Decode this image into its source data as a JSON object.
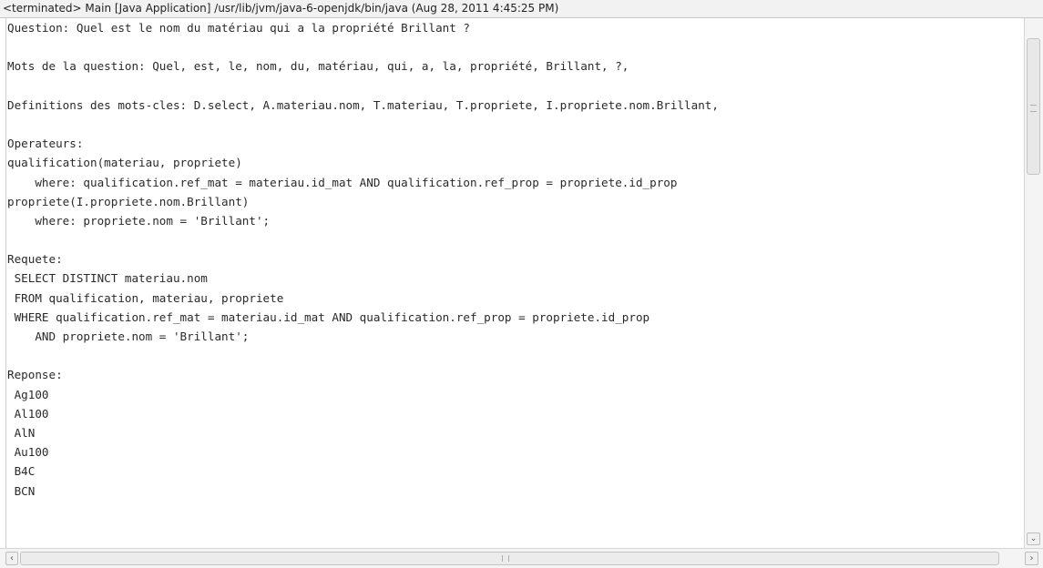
{
  "console": {
    "title": "<terminated> Main [Java Application] /usr/lib/jvm/java-6-openjdk/bin/java (Aug 28, 2011 4:45:25 PM)",
    "lines": [
      "Question: Quel est le nom du matériau qui a la propriété Brillant ?",
      "",
      "Mots de la question: Quel, est, le, nom, du, matériau, qui, a, la, propriété, Brillant, ?,",
      "",
      "Definitions des mots-cles: D.select, A.materiau.nom, T.materiau, T.propriete, I.propriete.nom.Brillant,",
      "",
      "Operateurs:",
      "qualification(materiau, propriete)",
      "    where: qualification.ref_mat = materiau.id_mat AND qualification.ref_prop = propriete.id_prop",
      "propriete(I.propriete.nom.Brillant)",
      "    where: propriete.nom = 'Brillant';",
      "",
      "Requete:",
      " SELECT DISTINCT materiau.nom",
      " FROM qualification, materiau, propriete",
      " WHERE qualification.ref_mat = materiau.id_mat AND qualification.ref_prop = propriete.id_prop",
      "    AND propriete.nom = 'Brillant';",
      "",
      "Reponse:",
      " Ag100",
      " Al100",
      " AlN",
      " Au100",
      " B4C",
      " BCN"
    ]
  },
  "scrollbars": {
    "vertical": {
      "down_icon": "chevron-down-icon",
      "down_glyph": "⌄"
    },
    "horizontal": {
      "left_icon": "chevron-left-icon",
      "left_glyph": "‹",
      "right_icon": "chevron-right-icon",
      "right_glyph": "›"
    }
  }
}
